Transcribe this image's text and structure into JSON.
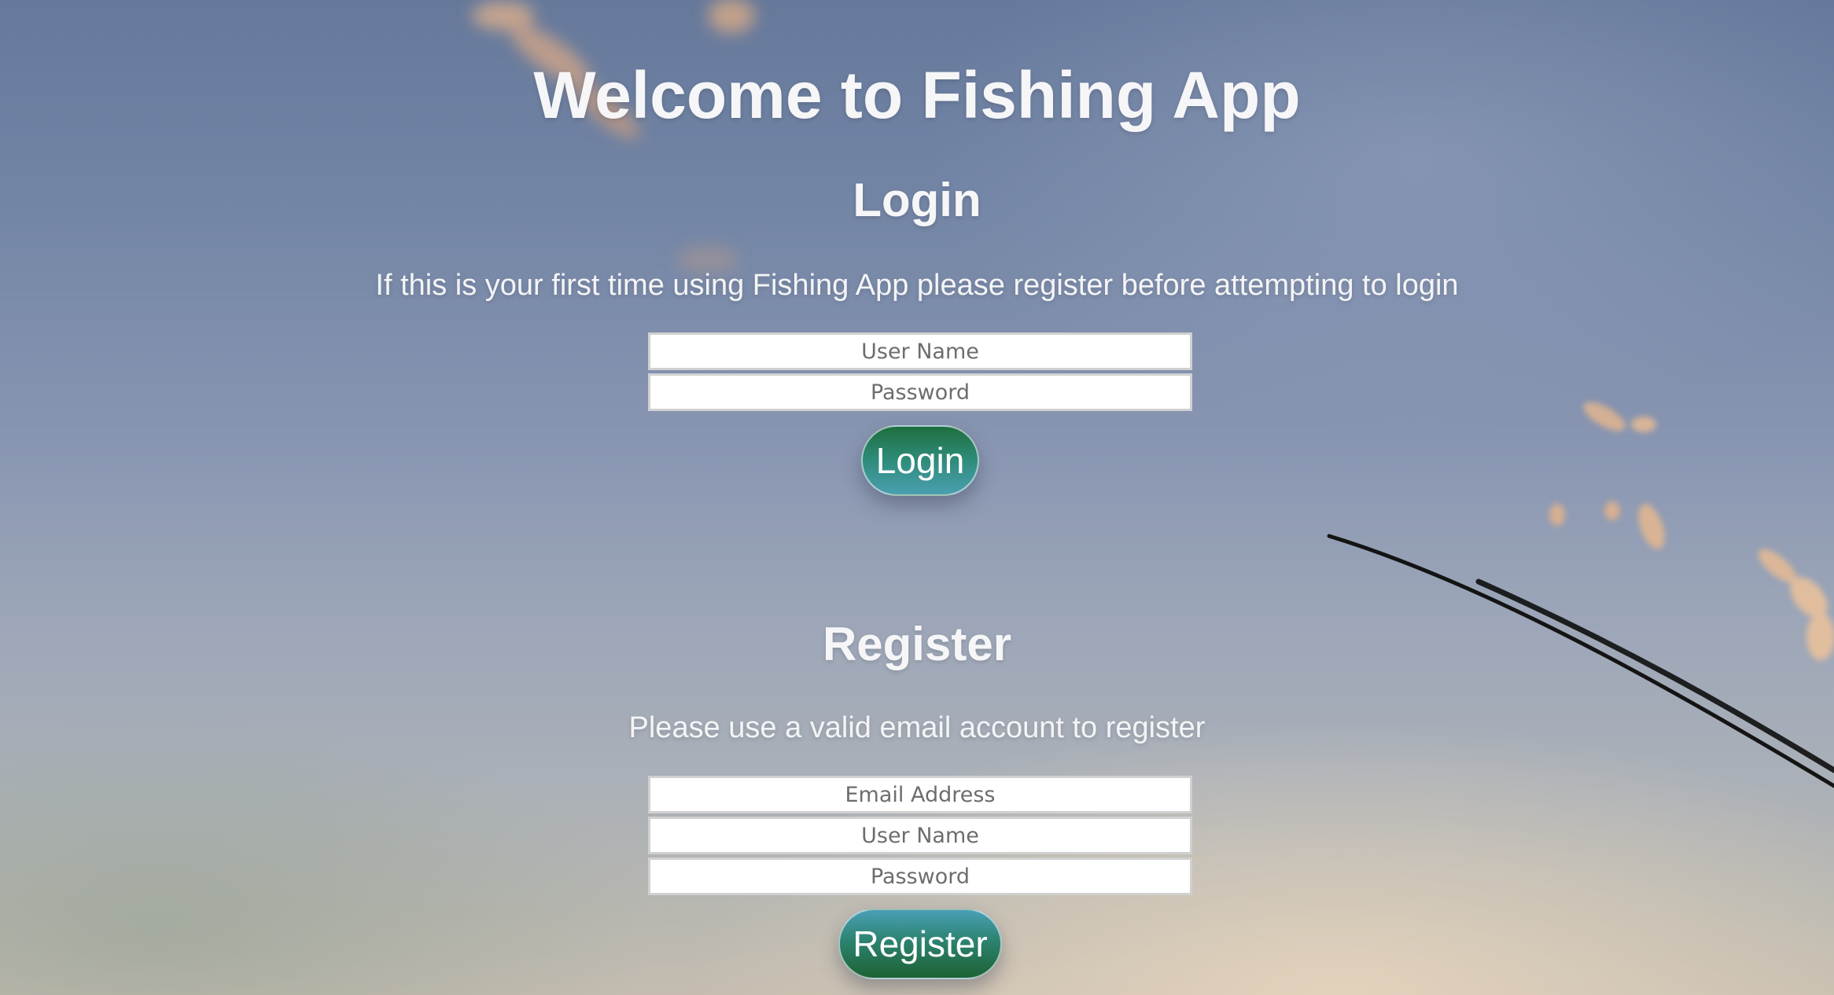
{
  "page": {
    "title": "Welcome to Fishing App"
  },
  "login": {
    "heading": "Login",
    "description": "If this is your first time using Fishing App please register before attempting to login",
    "username_placeholder": "User Name",
    "password_placeholder": "Password",
    "button_label": "Login"
  },
  "register": {
    "heading": "Register",
    "description": "Please use a valid email account to register",
    "email_placeholder": "Email Address",
    "username_placeholder": "User Name",
    "password_placeholder": "Password",
    "button_label": "Register"
  },
  "colors": {
    "sky_top": "#66799b",
    "sky_bottom": "#c4bcb0",
    "button_green": "#1e6e3e",
    "button_teal": "#4a9fb0",
    "text": "#ffffff"
  },
  "background": {
    "icon": "fishing-rod-icon",
    "scene": "sky-with-clouds"
  }
}
